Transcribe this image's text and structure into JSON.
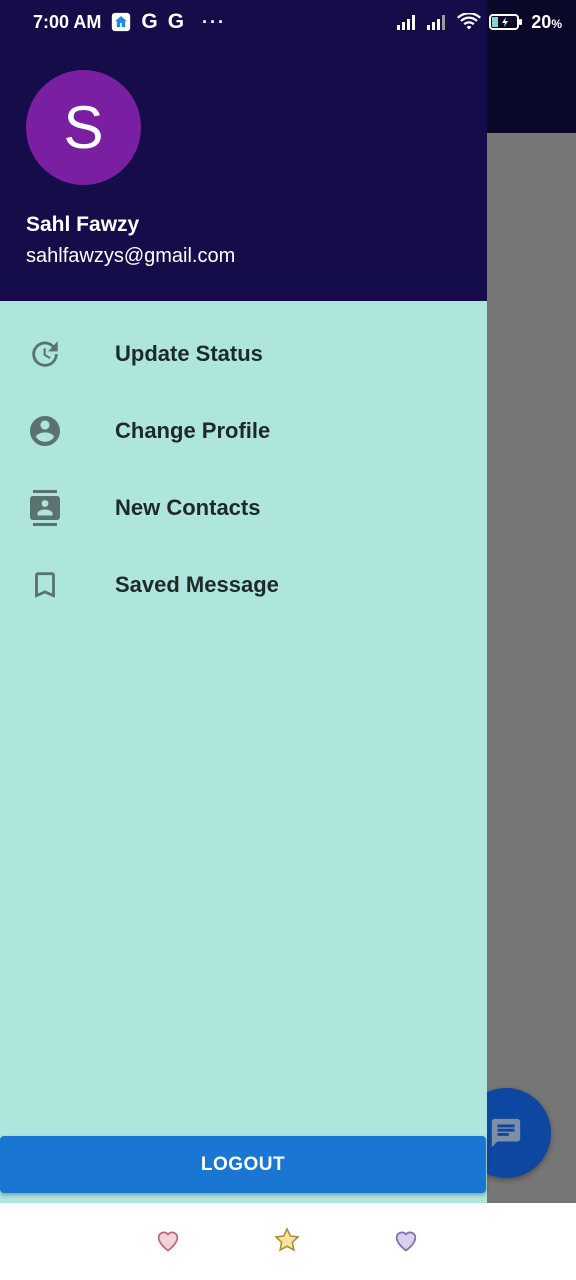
{
  "status_bar": {
    "time": "7:00 AM",
    "app_icons": [
      "home-icon",
      "google-icon",
      "google-icon"
    ],
    "google_glyph": "G",
    "more": "···",
    "battery": "20",
    "battery_unit": "%"
  },
  "drawer": {
    "avatar_initial": "S",
    "account_name": "Sahl Fawzy",
    "account_email": "sahlfawzys@gmail.com",
    "items": [
      {
        "label": "Update Status",
        "icon": "update-icon"
      },
      {
        "label": "Change Profile",
        "icon": "account-circle-icon"
      },
      {
        "label": "New Contacts",
        "icon": "contacts-icon"
      },
      {
        "label": "Saved Message",
        "icon": "bookmark-icon"
      }
    ],
    "logout_label": "LOGOUT"
  },
  "background": {
    "fab_icon": "message-icon"
  },
  "colors": {
    "header": "#140d4a",
    "drawer": "#aee6de",
    "avatar": "#7b1fa2",
    "logout": "#1976d2",
    "icon": "#5a7370"
  }
}
